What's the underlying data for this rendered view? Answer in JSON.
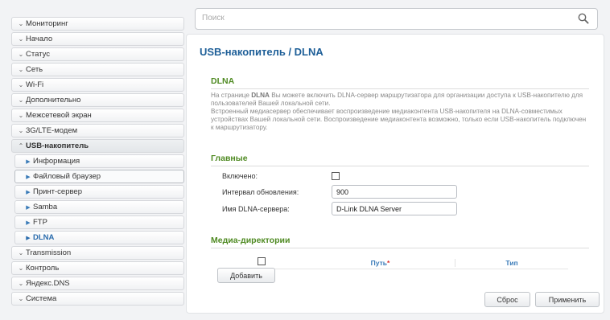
{
  "sidebar": {
    "items": [
      {
        "label": "Мониторинг"
      },
      {
        "label": "Начало"
      },
      {
        "label": "Статус"
      },
      {
        "label": "Сеть"
      },
      {
        "label": "Wi-Fi"
      },
      {
        "label": "Дополнительно"
      },
      {
        "label": "Межсетевой экран"
      },
      {
        "label": "3G/LTE-модем"
      },
      {
        "label": "USB-накопитель",
        "expanded": true
      },
      {
        "label": "Информация",
        "sub": true
      },
      {
        "label": "Файловый браузер",
        "sub": true
      },
      {
        "label": "Принт-сервер",
        "sub": true
      },
      {
        "label": "Samba",
        "sub": true
      },
      {
        "label": "FTP",
        "sub": true
      },
      {
        "label": "DLNA",
        "sub": true,
        "active": true
      },
      {
        "label": "Transmission"
      },
      {
        "label": "Контроль"
      },
      {
        "label": "Яндекс.DNS"
      },
      {
        "label": "Система"
      }
    ]
  },
  "search": {
    "placeholder": "Поиск"
  },
  "page": {
    "title": "USB-накопитель /  DLNA"
  },
  "dlna_section": {
    "title": "DLNA",
    "desc_part1": "На странице ",
    "desc_bold": "DLNA",
    "desc_part2": " Вы можете включить DLNA-сервер маршрутизатора для организации доступа к USB-накопителю для пользователей Вашей локальной сети.",
    "desc_line2": "Встроенный медиасервер обеспечивает воспроизведение медиаконтента USB-накопителя на DLNA-совместимых устройствах Вашей локальной сети. Воспроизведение медиаконтента возможно, только если USB-накопитель подключен к маршрутизатору."
  },
  "main_section": {
    "title": "Главные",
    "enabled_label": "Включено:",
    "enabled": false,
    "interval_label": "Интервал обновления:",
    "interval_value": "900",
    "server_name_label": "Имя DLNA-сервера:",
    "server_name_value": "D-Link DLNA Server"
  },
  "media_section": {
    "title": "Медиа-директории",
    "col_path": "Путь",
    "col_path_required": "*",
    "col_type": "Тип",
    "add_button": "Добавить"
  },
  "actions": {
    "reset": "Сброс",
    "apply": "Применить"
  },
  "colors": {
    "accent": "#1e5f98",
    "section_title": "#4f8a22",
    "link": "#3a7bb8"
  }
}
